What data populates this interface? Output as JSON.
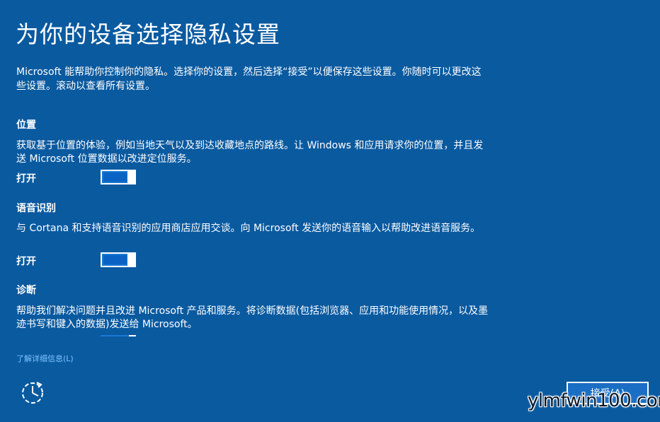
{
  "page": {
    "title": "为你的设备选择隐私设置",
    "intro": "Microsoft 能帮助你控制你的隐私。选择你的设置，然后选择“接受”以便保存这些设置。你随时可以更改这些设置。滚动以查看所有设置。"
  },
  "sections": [
    {
      "heading": "位置",
      "description": "获取基于位置的体验，例如当地天气以及到达收藏地点的路线。让 Windows 和应用请求你的位置，并且发送 Microsoft 位置数据以改进定位服务。",
      "toggle_label": "打开",
      "toggle_on": true
    },
    {
      "heading": "语音识别",
      "description": "与 Cortana 和支持语音识别的应用商店应用交谈。向 Microsoft 发送你的语音输入以帮助改进语音服务。",
      "toggle_label": "打开",
      "toggle_on": true
    },
    {
      "heading": "诊断",
      "description": "帮助我们解决问题并且改进 Microsoft 产品和服务。将诊断数据(包括浏览器、应用和功能使用情况，以及墨迹书写和键入的数据)发送给 Microsoft。",
      "toggle_on": true
    }
  ],
  "footer": {
    "learn_more": "了解详细信息(L)",
    "ease_of_access_icon": "ease-of-access-icon",
    "next_button": "接受(A)",
    "watermark": "ylmfwin100.com"
  },
  "colors": {
    "background": "#0a5aa0",
    "toggle_fill": "#1979d4",
    "link": "#7fc4ff"
  }
}
